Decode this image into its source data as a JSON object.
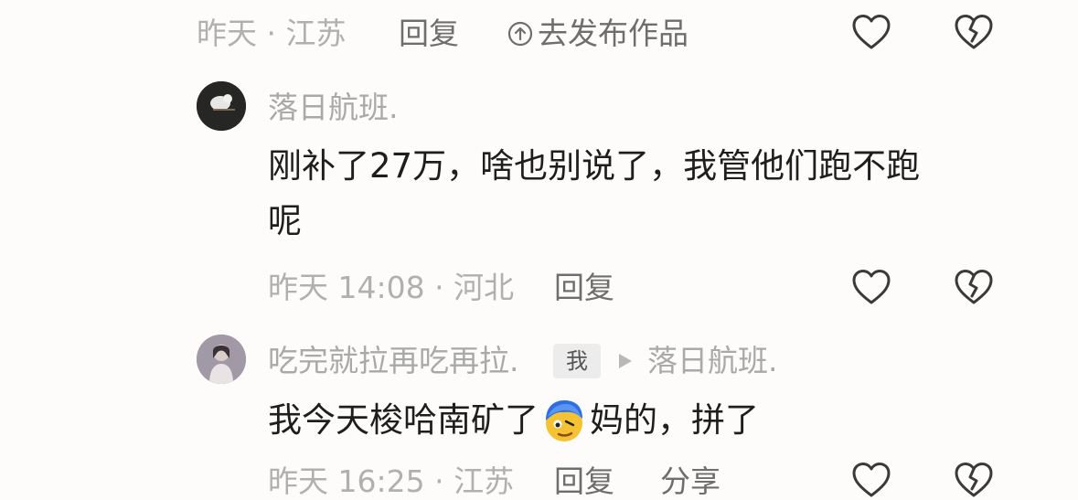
{
  "comments": [
    {
      "meta": {
        "time": "昨天",
        "location": "江苏"
      },
      "reply_label": "回复",
      "publish_label": "去发布作品"
    },
    {
      "user": "落日航班.",
      "text_line1": "刚补了27万，啥也别说了，我管他们跑不跑",
      "text_line2": "呢",
      "meta": {
        "time": "昨天 14:08",
        "location": "河北"
      },
      "reply_label": "回复"
    },
    {
      "user": "吃完就拉再吃再拉.",
      "me_badge": "我",
      "reply_to": "落日航班.",
      "text_before_emoji": "我今天梭哈南矿了",
      "emoji": "thinking-face-emoji",
      "text_after_emoji": "妈的，拼了",
      "meta": {
        "time": "昨天 16:25",
        "location": "江苏"
      },
      "reply_label": "回复",
      "share_label": "分享"
    }
  ],
  "colors": {
    "background": "#fdfcfa",
    "meta_text": "#b0b0b0",
    "reply_text": "#6e6e6e",
    "comment_text": "#1e1e1e"
  }
}
